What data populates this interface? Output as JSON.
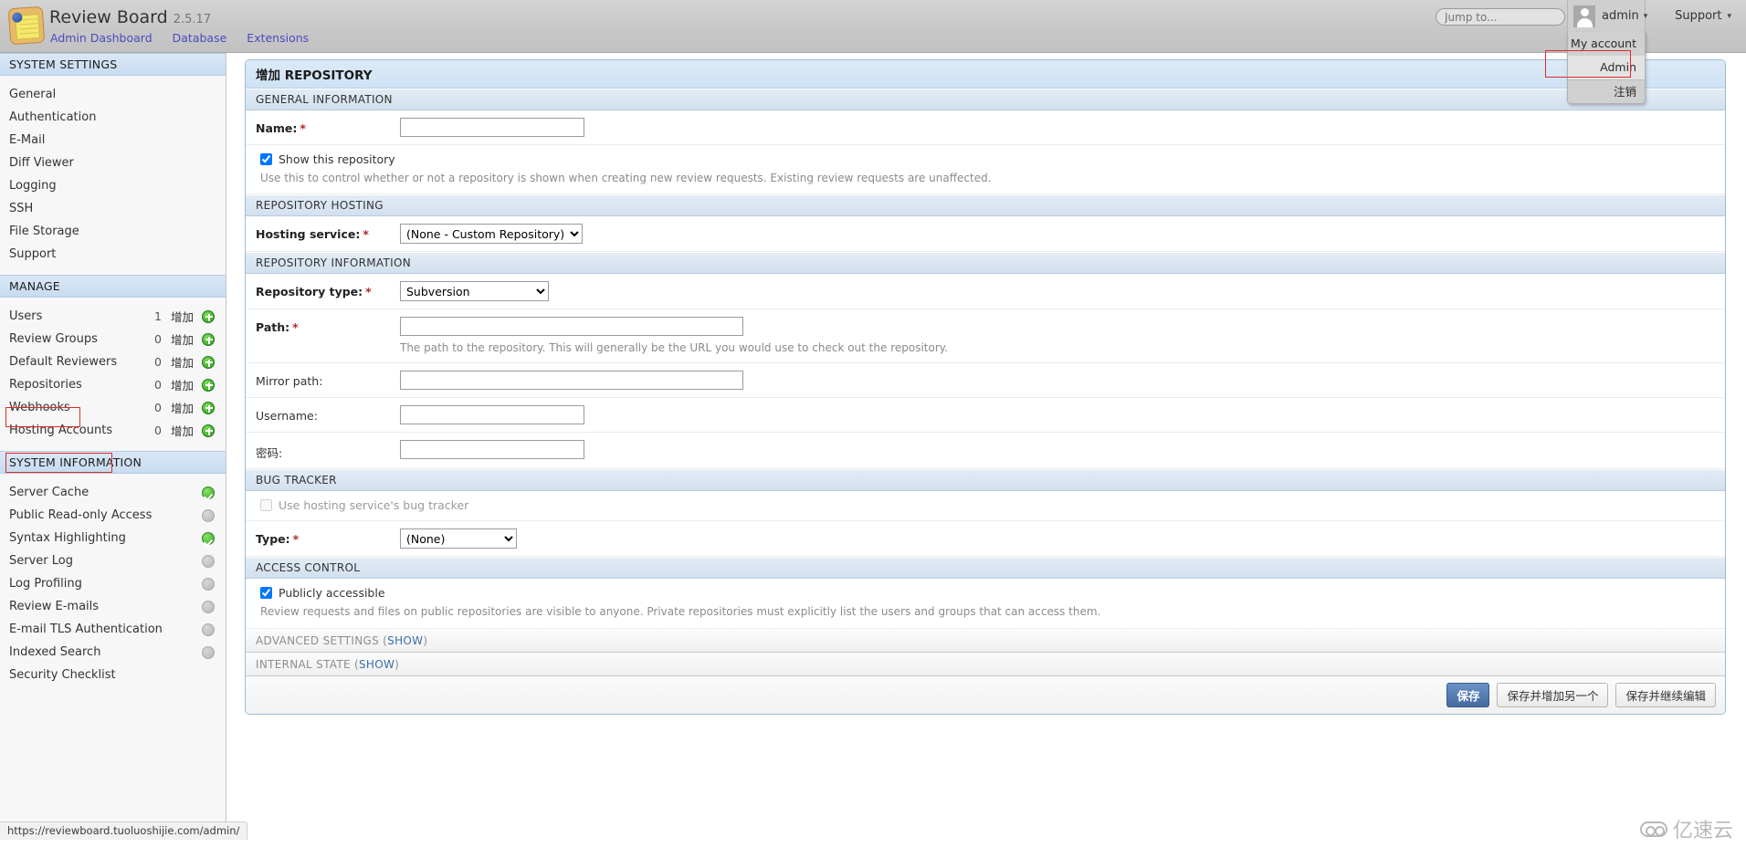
{
  "header": {
    "brand": "Review Board",
    "version": "2.5.17",
    "nav": [
      {
        "label": "Admin Dashboard"
      },
      {
        "label": "Database"
      },
      {
        "label": "Extensions"
      }
    ],
    "jump_to_placeholder": "Jump to...",
    "user_name": "admin",
    "caret": "▾",
    "support_label": "Support",
    "user_menu": [
      {
        "label": "My account",
        "selected": false
      },
      {
        "label": "Admin",
        "selected": true
      },
      {
        "label": "注销",
        "selected": false
      }
    ]
  },
  "sidebar": {
    "system_settings": {
      "title": "SYSTEM SETTINGS",
      "items": [
        {
          "label": "General"
        },
        {
          "label": "Authentication"
        },
        {
          "label": "E-Mail"
        },
        {
          "label": "Diff Viewer"
        },
        {
          "label": "Logging"
        },
        {
          "label": "SSH"
        },
        {
          "label": "File Storage"
        },
        {
          "label": "Support"
        }
      ]
    },
    "manage": {
      "title": "MANAGE",
      "add_label": "增加",
      "items": [
        {
          "label": "Users",
          "count": "1",
          "add": "增加",
          "highlighted": false
        },
        {
          "label": "Review Groups",
          "count": "0",
          "add": "增加",
          "highlighted": false
        },
        {
          "label": "Default Reviewers",
          "count": "0",
          "add": "增加",
          "highlighted": false
        },
        {
          "label": "Repositories",
          "count": "0",
          "add": "增加",
          "highlighted": true
        },
        {
          "label": "Webhooks",
          "count": "0",
          "add": "增加",
          "highlighted": false
        },
        {
          "label": "Hosting Accounts",
          "count": "0",
          "add": "增加",
          "highlighted": true
        }
      ]
    },
    "system_information": {
      "title": "SYSTEM INFORMATION",
      "items": [
        {
          "label": "Server Cache",
          "status": "on"
        },
        {
          "label": "Public Read-only Access",
          "status": "off"
        },
        {
          "label": "Syntax Highlighting",
          "status": "on"
        },
        {
          "label": "Server Log",
          "status": "off"
        },
        {
          "label": "Log Profiling",
          "status": "off"
        },
        {
          "label": "Review E-mails",
          "status": "off"
        },
        {
          "label": "E-mail TLS Authentication",
          "status": "off"
        },
        {
          "label": "Indexed Search",
          "status": "off"
        },
        {
          "label": "Security Checklist",
          "status": "none"
        }
      ]
    }
  },
  "main": {
    "panel_title": "增加 REPOSITORY",
    "sections": {
      "general": {
        "title": "GENERAL INFORMATION",
        "name_label": "Name:",
        "name_value": "",
        "show_repo_label": "Show this repository",
        "show_repo_checked": true,
        "show_repo_help": "Use this to control whether or not a repository is shown when creating new review requests. Existing review requests are unaffected."
      },
      "hosting": {
        "title": "REPOSITORY HOSTING",
        "service_label": "Hosting service:",
        "service_value": "(None - Custom Repository)"
      },
      "repo_info": {
        "title": "REPOSITORY INFORMATION",
        "type_label": "Repository type:",
        "type_value": "Subversion",
        "path_label": "Path:",
        "path_value": "",
        "path_help": "The path to the repository. This will generally be the URL you would use to check out the repository.",
        "mirror_label": "Mirror path:",
        "mirror_value": "",
        "username_label": "Username:",
        "username_value": "",
        "password_label": "密码:",
        "password_value": ""
      },
      "bug_tracker": {
        "title": "BUG TRACKER",
        "use_hosting_label": "Use hosting service's bug tracker",
        "use_hosting_checked": false,
        "type_label": "Type:",
        "type_value": "(None)"
      },
      "access_control": {
        "title": "ACCESS CONTROL",
        "public_label": "Publicly accessible",
        "public_checked": true,
        "public_help": "Review requests and files on public repositories are visible to anyone. Private repositories must explicitly list the users and groups that can access them."
      },
      "advanced": {
        "title": "ADVANCED SETTINGS",
        "toggle": "SHOW"
      },
      "internal": {
        "title": "INTERNAL STATE",
        "toggle": "SHOW"
      }
    },
    "buttons": {
      "save": "保存",
      "save_add_another": "保存并增加另一个",
      "save_continue": "保存并继续编辑"
    }
  },
  "status_bar": {
    "url": "https://reviewboard.tuoluoshijie.com/admin/"
  },
  "watermark": {
    "text": "亿速云"
  },
  "colors": {
    "section_band": "#d2e0ee",
    "panel_border": "#9dbbd6",
    "annotation": "#e02a2a",
    "primary_button": "#44699f",
    "status_on": "#35a522",
    "status_off": "#b6b6b6"
  }
}
